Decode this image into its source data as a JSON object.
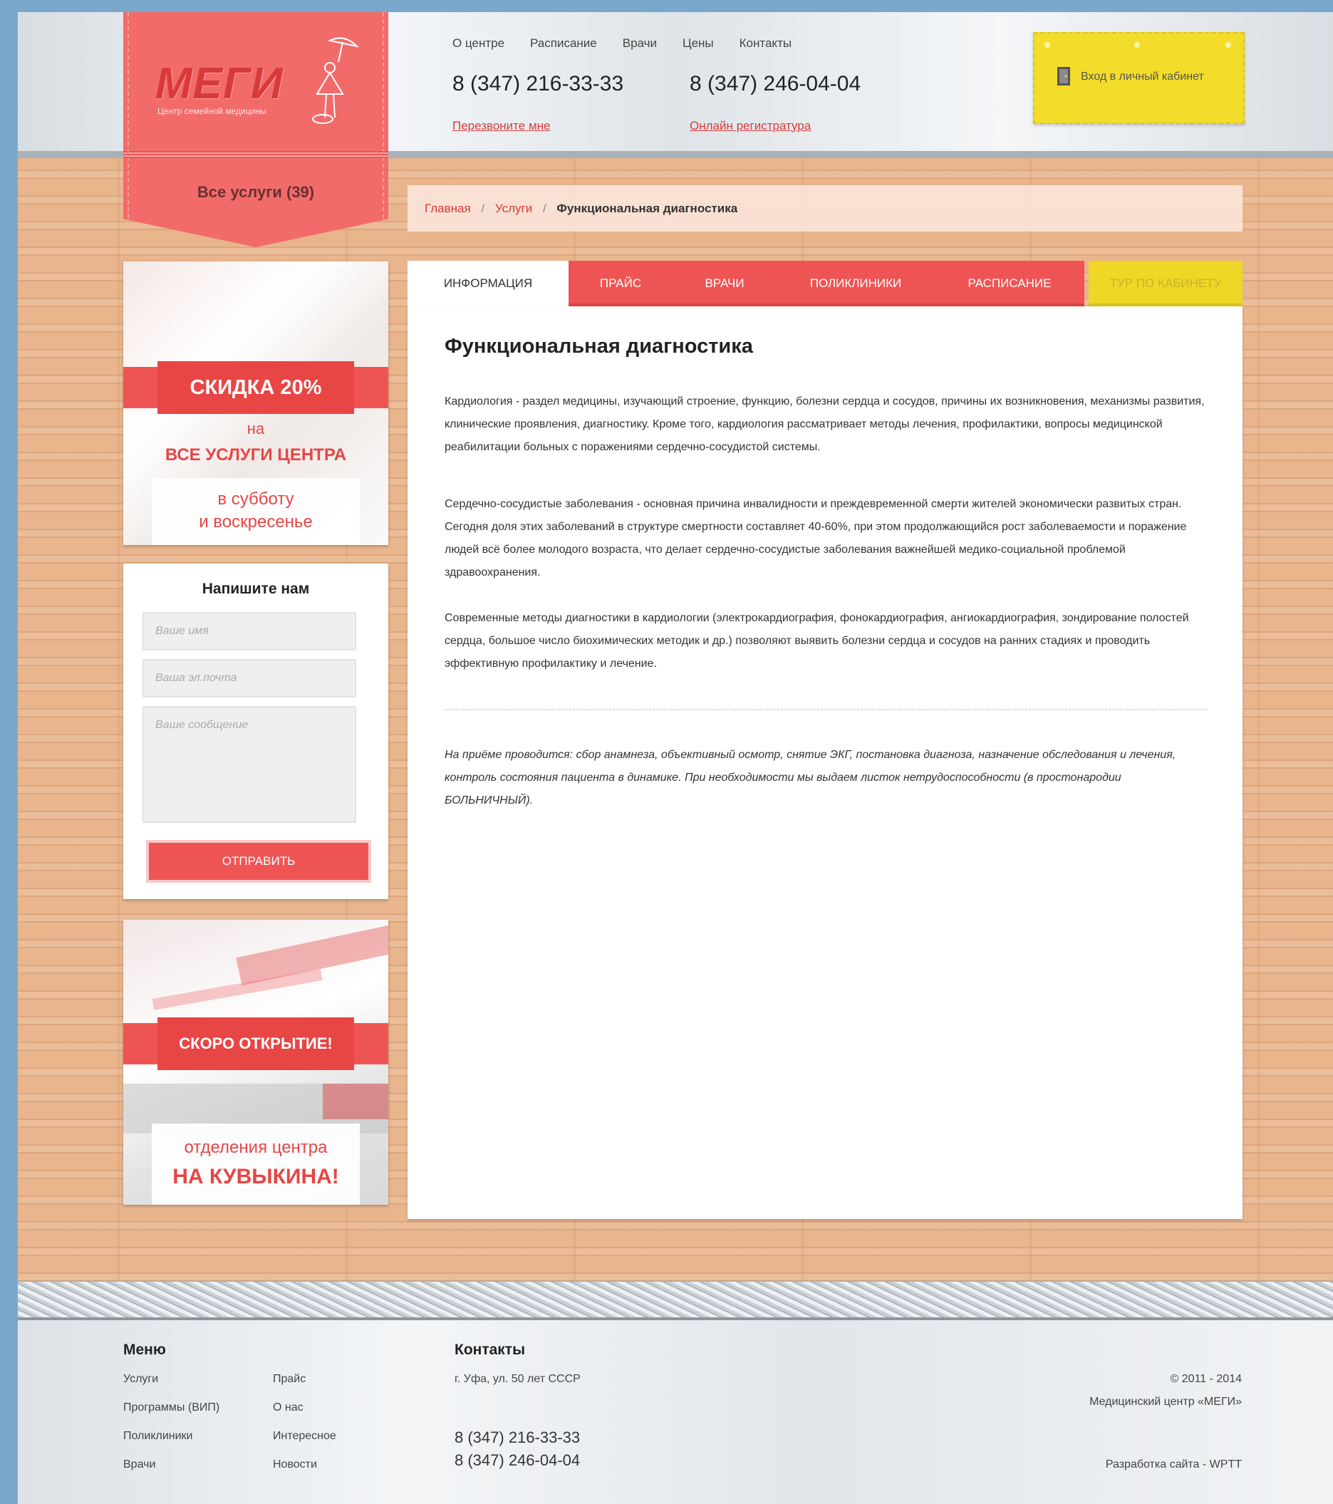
{
  "header": {
    "logo": "МЕГИ",
    "logo_sub": "Центр семейной медицины",
    "all_services": "Все услуги (39)",
    "nav": [
      "О центре",
      "Расписание",
      "Врачи",
      "Цены",
      "Контакты"
    ],
    "phone1": "8 (347) 216-33-33",
    "phone1_link": "Перезвоните мне",
    "phone2": "8 (347) 246-04-04",
    "phone2_link": "Онлайн регистратура",
    "login": "Вход в личный кабинет"
  },
  "breadcrumb": {
    "home": "Главная",
    "sep": "/",
    "services": "Услуги",
    "current": "Функциональная диагностика"
  },
  "promo1": {
    "title": "СКИДКА 20%",
    "line1": "на",
    "line2": "ВСЕ УСЛУГИ ЦЕНТРА",
    "box1": "в субботу",
    "box2": "и воскресенье"
  },
  "form": {
    "title": "Напишите нам",
    "name_placeholder": "Ваше имя",
    "email_placeholder": "Ваша эл.почта",
    "message_placeholder": "Ваше сообщение",
    "submit": "ОТПРАВИТЬ"
  },
  "promo2": {
    "title": "СКОРО ОТКРЫТИЕ!",
    "line1": "отделения центра",
    "line2": "НА КУВЫКИНА!"
  },
  "tabs": [
    {
      "label": "ИНФОРМАЦИЯ"
    },
    {
      "label": "ПРАЙС"
    },
    {
      "label": "ВРАЧИ"
    },
    {
      "label": "ПОЛИКЛИНИКИ"
    },
    {
      "label": "РАСПИСАНИЕ"
    },
    {
      "label": "ТУР ПО КАБИНЕТУ"
    }
  ],
  "content": {
    "title": "Функциональная диагностика",
    "p1": "Кардиология - раздел медицины, изучающий строение, функцию, болезни сердца и сосудов, причины их возникновения, механизмы развития, клинические проявления, диагностику. Кроме того, кардиология рассматривает методы лечения, профилактики, вопросы медицинской реабилитации больных с поражениями сердечно-сосудистой системы.",
    "p2": "Сердечно-сосудистые заболевания - основная причина инвалидности и преждевременной смерти жителей экономически развитых стран. Сегодня доля этих заболеваний в структуре смертности составляет 40-60%, при этом продолжающийся рост заболеваемости и поражение людей всё более молодого возраста, что делает сердечно-сосудистые заболевания важнейшей медико-социальной проблемой здравоохранения.",
    "p3": "Современные методы диагностики в кардиологии (электрокардиография, фонокардиография, ангиокардиография, зондирование полостей сердца, большое число биохимических методик и др.) позволяют выявить болезни сердца и сосудов на ранних стадиях и проводить эффективную профилактику и лечение.",
    "p4": "На приёме проводится: сбор анамнеза, объективный осмотр, снятие ЭКГ,  постановка диагноза, назначение обследования и лечения, контроль состояния пациента в динамике. При необходимости мы выдаем листок нетрудоспособности (в простонародии БОЛЬНИЧНЫЙ)."
  },
  "footer": {
    "menu_title": "Меню",
    "menu_col1": [
      "Услуги",
      "Программы (ВИП)",
      "Поликлиники",
      "Врачи"
    ],
    "menu_col2": [
      "Прайс",
      "О нас",
      "Интересное",
      "Новости"
    ],
    "contacts_title": "Контакты",
    "address": "г. Уфа, ул. 50 лет СССР",
    "phone1": "8 (347) 216-33-33",
    "phone2": "8 (347) 246-04-04",
    "copyright": "© 2011 - 2014",
    "company": "Медицинский центр «МЕГИ»",
    "developer": "Разработка сайта - WPTT"
  },
  "colors": {
    "accent": "#ef5454",
    "yellow": "#f0d625",
    "wood": "#e9b58c"
  }
}
